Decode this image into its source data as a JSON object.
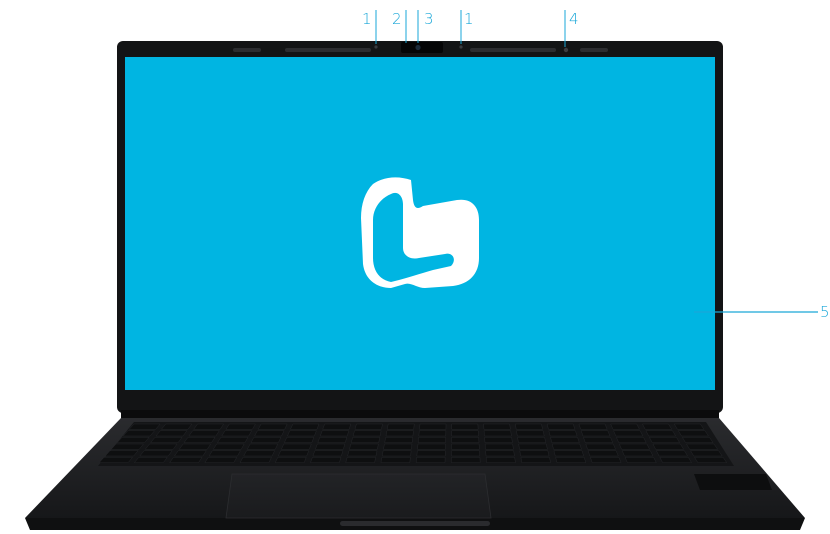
{
  "colors": {
    "accent": "#1aa7d8",
    "screen": "#00b5e2",
    "bezel": "#131415",
    "body": "#1a1b1d",
    "keys": "#0e0f10",
    "logo": "#ffffff"
  },
  "callouts": [
    {
      "number": "1",
      "meaning": "microphone"
    },
    {
      "number": "2",
      "meaning": "webcam"
    },
    {
      "number": "3",
      "meaning": "webcam"
    },
    {
      "number": "1",
      "meaning": "microphone"
    },
    {
      "number": "4",
      "meaning": "status-led"
    },
    {
      "number": "5",
      "meaning": "display"
    }
  ],
  "icons": {
    "screen_logo": "thumbs-up-logo-icon",
    "webcam": "webcam-icon",
    "microphone": "microphone-icon",
    "led": "led-indicator-icon"
  }
}
